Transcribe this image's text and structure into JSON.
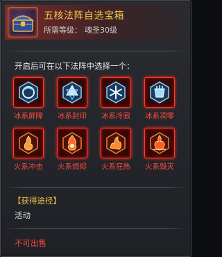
{
  "item": {
    "title": "五核法阵自选宝箱",
    "requirement_label": "所需等级：",
    "requirement_value": "魂圣30级",
    "icon": "treasure-chest-icon"
  },
  "prompt": "开启后可在以下法阵中选择一个：",
  "options": [
    {
      "label": "冰系屏障",
      "element": "ice",
      "icon": "ice-barrier-icon"
    },
    {
      "label": "冰系封印",
      "element": "ice",
      "icon": "ice-seal-icon"
    },
    {
      "label": "冰系冷寂",
      "element": "ice",
      "icon": "ice-silence-icon"
    },
    {
      "label": "冰系凋零",
      "element": "ice",
      "icon": "ice-wither-icon"
    },
    {
      "label": "火系冲击",
      "element": "fire",
      "icon": "fire-impact-icon"
    },
    {
      "label": "火系燃烬",
      "element": "fire",
      "icon": "fire-ember-icon"
    },
    {
      "label": "火系狂热",
      "element": "fire",
      "icon": "fire-frenzy-icon"
    },
    {
      "label": "火系毁灭",
      "element": "fire",
      "icon": "fire-destroy-icon"
    }
  ],
  "obtain": {
    "heading": "【获得途径】",
    "source": "活动"
  },
  "trade_status": "不可出售",
  "colors": {
    "title": "#f3c94a",
    "frame": "#ff3b2e",
    "label_red": "#ff4a3c",
    "ice": "#7fd4ff",
    "fire": "#ff7a2a"
  }
}
